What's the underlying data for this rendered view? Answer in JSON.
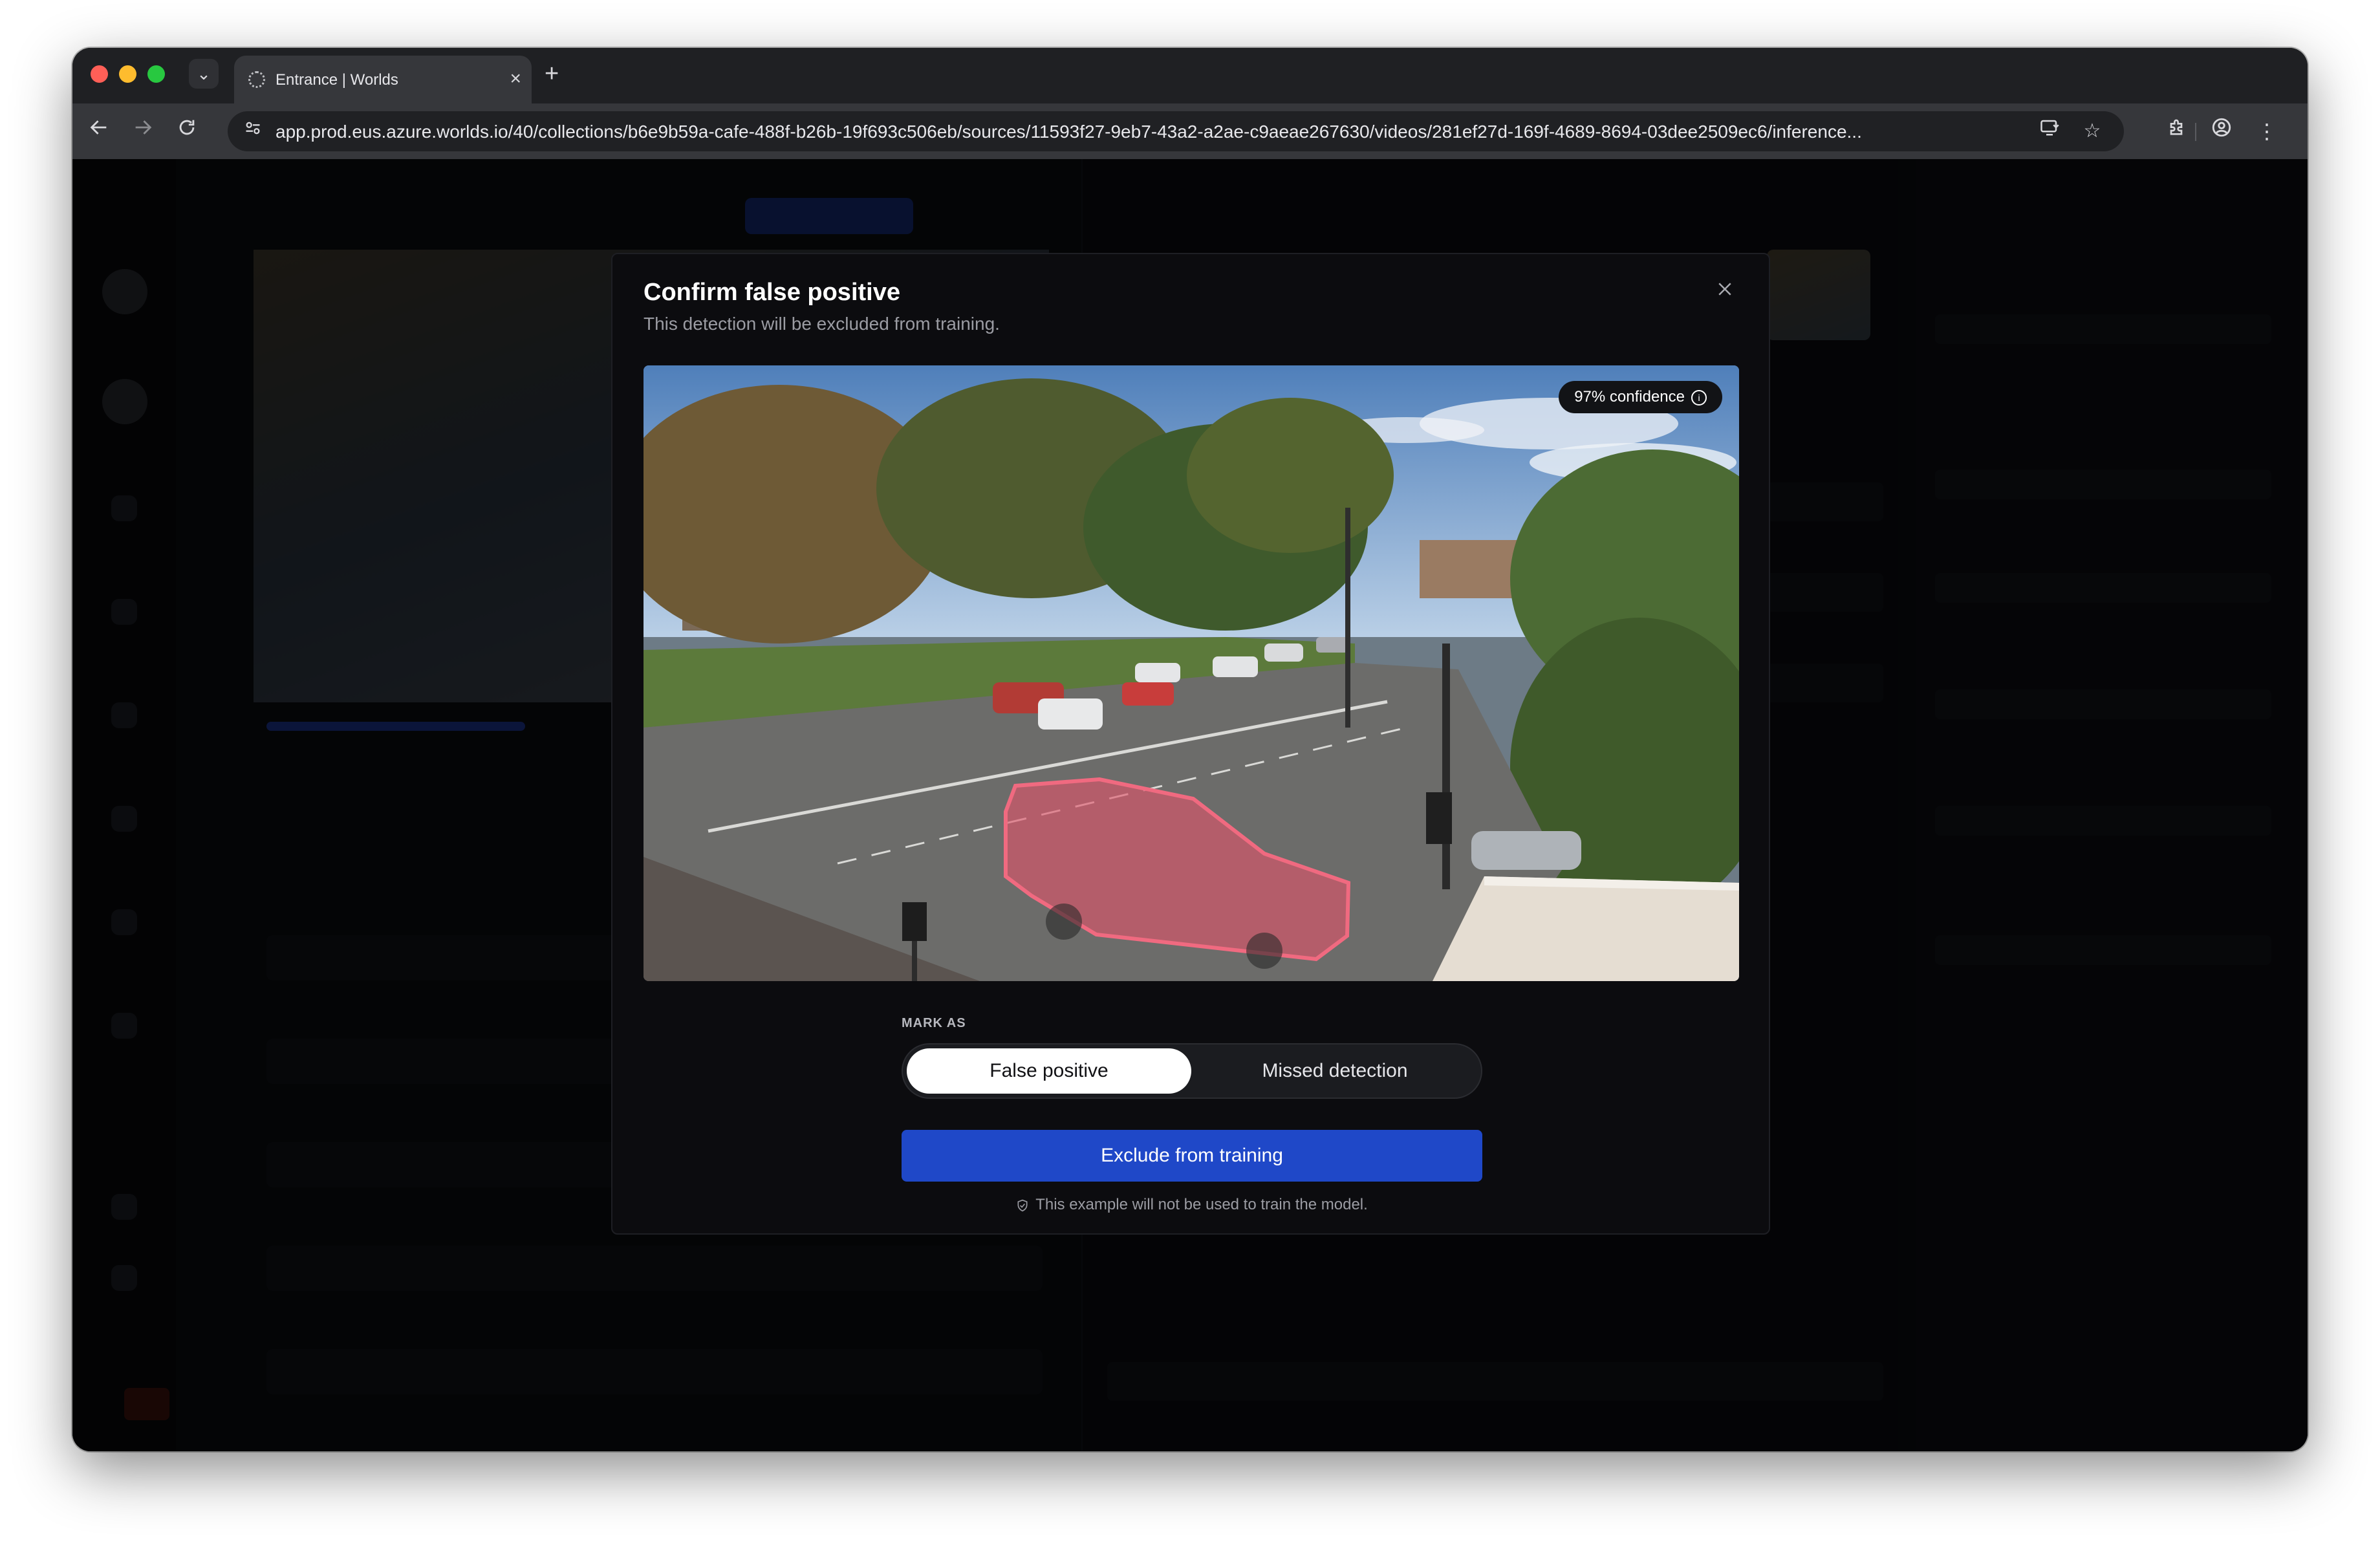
{
  "browser": {
    "tab_title": "Entrance | Worlds",
    "url": "app.prod.eus.azure.worlds.io/40/collections/b6e9b59a-cafe-488f-b26b-19f693c506eb/sources/11593f27-9eb7-43a2-a2ae-c9aeae267630/videos/281ef27d-169f-4689-8694-03dee2509ec6/inference...",
    "icons": {
      "back": "back-arrow-icon",
      "forward": "forward-arrow-icon",
      "reload": "reload-icon",
      "site_info": "site-info-icon",
      "install": "install-app-icon",
      "bookmark": "star-icon",
      "extensions": "extensions-icon",
      "profile": "profile-icon",
      "menu": "kebab-menu-icon"
    }
  },
  "modal": {
    "title": "Confirm false positive",
    "subtitle": "This detection will be excluded from training.",
    "confidence": "97% confidence",
    "mark_as_label": "MARK AS",
    "options": [
      {
        "label": "False positive",
        "selected": true
      },
      {
        "label": "Missed detection",
        "selected": false
      }
    ],
    "primary_button": "Exclude from training",
    "note": "This example will not be used to train the model."
  },
  "colors": {
    "accent": "#1f48c8",
    "mask": "#e0546b",
    "modal_bg": "#0c0c0f"
  }
}
